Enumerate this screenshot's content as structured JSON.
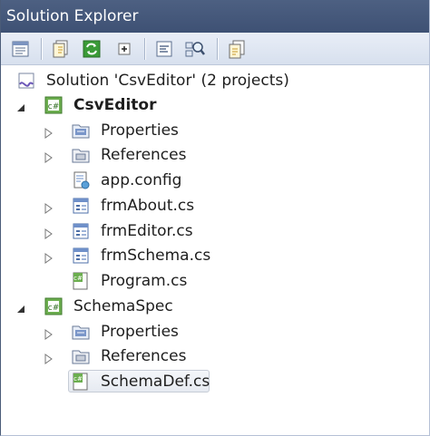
{
  "window": {
    "title": "Solution Explorer"
  },
  "toolbar": {
    "buttons": [
      "properties-icon",
      "show-all-files-icon",
      "refresh-icon",
      "collapse-icon",
      "view-code-icon",
      "view-class-diagram-icon",
      "copy-icon"
    ]
  },
  "tree": {
    "solution": {
      "label": "Solution 'CsvEditor' (2 projects)"
    },
    "projects": [
      {
        "label": "CsvEditor",
        "items": [
          {
            "label": "Properties"
          },
          {
            "label": "References"
          },
          {
            "label": "app.config"
          },
          {
            "label": "frmAbout.cs"
          },
          {
            "label": "frmEditor.cs"
          },
          {
            "label": "frmSchema.cs"
          },
          {
            "label": "Program.cs"
          }
        ]
      },
      {
        "label": "SchemaSpec",
        "items": [
          {
            "label": "Properties"
          },
          {
            "label": "References"
          },
          {
            "label": "SchemaDef.cs"
          }
        ]
      }
    ]
  },
  "colors": {
    "titlebar": "#3e5174",
    "toolbar": "#d7e0ee",
    "selection_border": "#c6ccd6"
  }
}
